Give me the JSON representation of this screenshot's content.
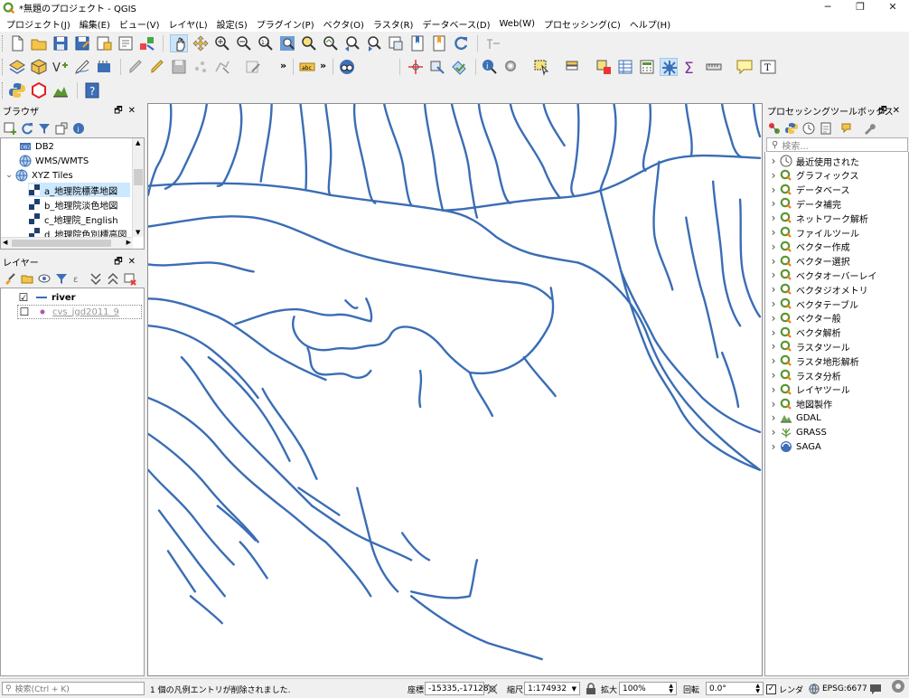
{
  "window": {
    "title": "*無題のプロジェクト - QGIS",
    "minimize": "─",
    "restore": "❐",
    "close": "✕"
  },
  "menu": [
    "プロジェクト(J)",
    "編集(E)",
    "ビュー(V)",
    "レイヤ(L)",
    "設定(S)",
    "プラグイン(P)",
    "ベクタ(O)",
    "ラスタ(R)",
    "データベース(D)",
    "Web(W)",
    "プロセッシング(C)",
    "ヘルプ(H)"
  ],
  "browser": {
    "title": "ブラウザ",
    "items": [
      {
        "label": "DB2"
      },
      {
        "label": "WMS/WMTS"
      },
      {
        "label": "XYZ Tiles",
        "arrow": "⌄"
      },
      {
        "label": "a_地理院標準地図"
      },
      {
        "label": "b_地理院淡色地図"
      },
      {
        "label": "c_地理院_English"
      },
      {
        "label": "d_地理院色別標高図"
      }
    ]
  },
  "layers": {
    "title": "レイヤー",
    "items": [
      {
        "label": "river",
        "checked": "☑"
      },
      {
        "label": "cvs_jgd2011_9",
        "checked": "☐"
      }
    ]
  },
  "processing": {
    "title": "プロセッシングツールボックス",
    "search_placeholder": "検索...",
    "items": [
      {
        "label": "最近使用された",
        "icon": "clock-icon"
      },
      {
        "label": "グラフィックス",
        "icon": "qgis-q-icon"
      },
      {
        "label": "データベース",
        "icon": "qgis-q-icon"
      },
      {
        "label": "データ補完",
        "icon": "qgis-q-icon"
      },
      {
        "label": "ネットワーク解析",
        "icon": "qgis-q-icon"
      },
      {
        "label": "ファイルツール",
        "icon": "qgis-q-icon"
      },
      {
        "label": "ベクター作成",
        "icon": "qgis-q-icon"
      },
      {
        "label": "ベクター選択",
        "icon": "qgis-q-icon"
      },
      {
        "label": "ベクタオーバーレイ",
        "icon": "qgis-q-icon"
      },
      {
        "label": "ベクタジオメトリ",
        "icon": "qgis-q-icon"
      },
      {
        "label": "ベクタテーブル",
        "icon": "qgis-q-icon"
      },
      {
        "label": "ベクター般",
        "icon": "qgis-q-icon"
      },
      {
        "label": "ベクタ解析",
        "icon": "qgis-q-icon"
      },
      {
        "label": "ラスタツール",
        "icon": "qgis-q-icon"
      },
      {
        "label": "ラスタ地形解析",
        "icon": "qgis-q-icon"
      },
      {
        "label": "ラスタ分析",
        "icon": "qgis-q-icon"
      },
      {
        "label": "レイヤツール",
        "icon": "qgis-q-icon"
      },
      {
        "label": "地図製作",
        "icon": "qgis-q-icon"
      },
      {
        "label": "GDAL",
        "icon": "gdal-icon"
      },
      {
        "label": "GRASS",
        "icon": "grass-icon"
      },
      {
        "label": "SAGA",
        "icon": "saga-icon"
      }
    ]
  },
  "status": {
    "locator_placeholder": "検索(Ctrl + K)",
    "message": "1 個の凡例エントリが削除されました.",
    "coord_label": "座標",
    "coord_value": "-15335,-17128",
    "scale_label": "縮尺",
    "scale_value": "1:174932",
    "mag_label": "拡大",
    "mag_value": "100%",
    "rot_label": "回転",
    "rot_value": "0.0°",
    "render_label": "レンダ",
    "crs": "EPSG:6677"
  },
  "colors": {
    "river": "#3a6db5",
    "accent": "#589632"
  }
}
